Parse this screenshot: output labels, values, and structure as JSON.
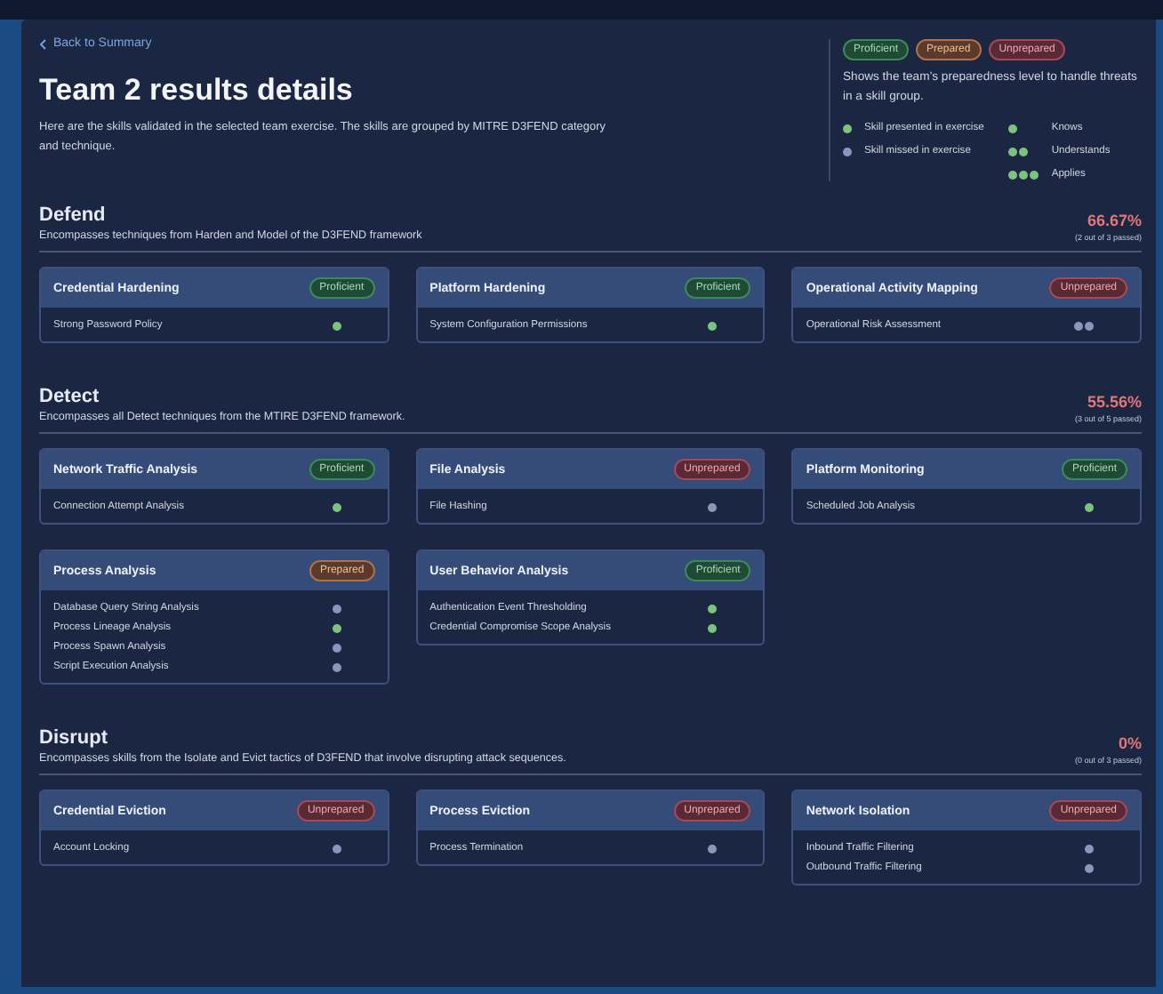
{
  "back_link": "Back to Summary",
  "title": "Team 2 results details",
  "description": "Here are the skills validated in the selected team exercise. The skills are grouped by MITRE D3FEND category and technique.",
  "legend": {
    "badges": [
      {
        "label": "Proficient",
        "kind": "proficient"
      },
      {
        "label": "Prepared",
        "kind": "prepared"
      },
      {
        "label": "Unprepared",
        "kind": "unprepared"
      }
    ],
    "text": "Shows the team’s preparedness level to handle threats in a skill group.",
    "skill_states": [
      {
        "label": "Skill presented in exercise",
        "presented": true
      },
      {
        "label": "Skill missed in exercise",
        "presented": false
      }
    ],
    "depths": [
      {
        "label": "Knows",
        "kind": "knows"
      },
      {
        "label": "Understands",
        "kind": "understands"
      },
      {
        "label": "Applies",
        "kind": "applies"
      }
    ]
  },
  "sections": [
    {
      "name": "Defend",
      "description": "Encompasses techniques from Harden and Model of the D3FEND framework",
      "percent": "66.67%",
      "passed": "(2 out of 3 passed)",
      "groups": [
        {
          "name": "Credential Hardening",
          "badge": "Proficient",
          "kind": "proficient",
          "skills": [
            {
              "name": "Strong Password Policy",
              "presented": true,
              "kind": "knows"
            }
          ]
        },
        {
          "name": "Platform Hardening",
          "badge": "Proficient",
          "kind": "proficient",
          "skills": [
            {
              "name": "System Configuration Permissions",
              "presented": true,
              "kind": "knows"
            }
          ]
        },
        {
          "name": "Operational Activity Mapping",
          "badge": "Unprepared",
          "kind": "unprepared",
          "skills": [
            {
              "name": "Operational Risk Assessment",
              "presented": false,
              "kind": "understands"
            }
          ]
        }
      ]
    },
    {
      "name": "Detect",
      "description": "Encompasses all Detect techniques from the MTIRE D3FEND framework.",
      "percent": "55.56%",
      "passed": "(3 out of 5 passed)",
      "groups": [
        {
          "name": "Network Traffic Analysis",
          "badge": "Proficient",
          "kind": "proficient",
          "skills": [
            {
              "name": "Connection Attempt Analysis",
              "presented": true,
              "kind": "knows"
            }
          ]
        },
        {
          "name": "File Analysis",
          "badge": "Unprepared",
          "kind": "unprepared",
          "skills": [
            {
              "name": "File Hashing",
              "presented": false,
              "kind": "knows"
            }
          ]
        },
        {
          "name": "Platform Monitoring",
          "badge": "Proficient",
          "kind": "proficient",
          "skills": [
            {
              "name": "Scheduled Job Analysis",
              "presented": true,
              "kind": "knows"
            }
          ]
        },
        {
          "name": "Process Analysis",
          "badge": "Prepared",
          "kind": "prepared",
          "skills": [
            {
              "name": "Database Query String Analysis",
              "presented": false,
              "kind": "knows"
            },
            {
              "name": "Process Lineage Analysis",
              "presented": true,
              "kind": "knows"
            },
            {
              "name": "Process Spawn Analysis",
              "presented": false,
              "kind": "knows"
            },
            {
              "name": "Script Execution Analysis",
              "presented": false,
              "kind": "knows"
            }
          ]
        },
        {
          "name": "User Behavior Analysis",
          "badge": "Proficient",
          "kind": "proficient",
          "skills": [
            {
              "name": "Authentication Event Thresholding",
              "presented": true,
              "kind": "knows"
            },
            {
              "name": "Credential Compromise Scope Analysis",
              "presented": true,
              "kind": "knows"
            }
          ]
        }
      ]
    },
    {
      "name": "Disrupt",
      "description": "Encompasses skills from the Isolate and Evict tactics of D3FEND that involve disrupting attack sequences.",
      "percent": "0%",
      "passed": "(0 out of 3 passed)",
      "groups": [
        {
          "name": "Credential Eviction",
          "badge": "Unprepared",
          "kind": "unprepared",
          "skills": [
            {
              "name": "Account Locking",
              "presented": false,
              "kind": "knows"
            }
          ]
        },
        {
          "name": "Process Eviction",
          "badge": "Unprepared",
          "kind": "unprepared",
          "skills": [
            {
              "name": "Process Termination",
              "presented": false,
              "kind": "knows"
            }
          ]
        },
        {
          "name": "Network Isolation",
          "badge": "Unprepared",
          "kind": "unprepared",
          "skills": [
            {
              "name": "Inbound Traffic Filtering",
              "presented": false,
              "kind": "knows"
            },
            {
              "name": "Outbound Traffic Filtering",
              "presented": false,
              "kind": "knows"
            }
          ]
        }
      ]
    }
  ]
}
